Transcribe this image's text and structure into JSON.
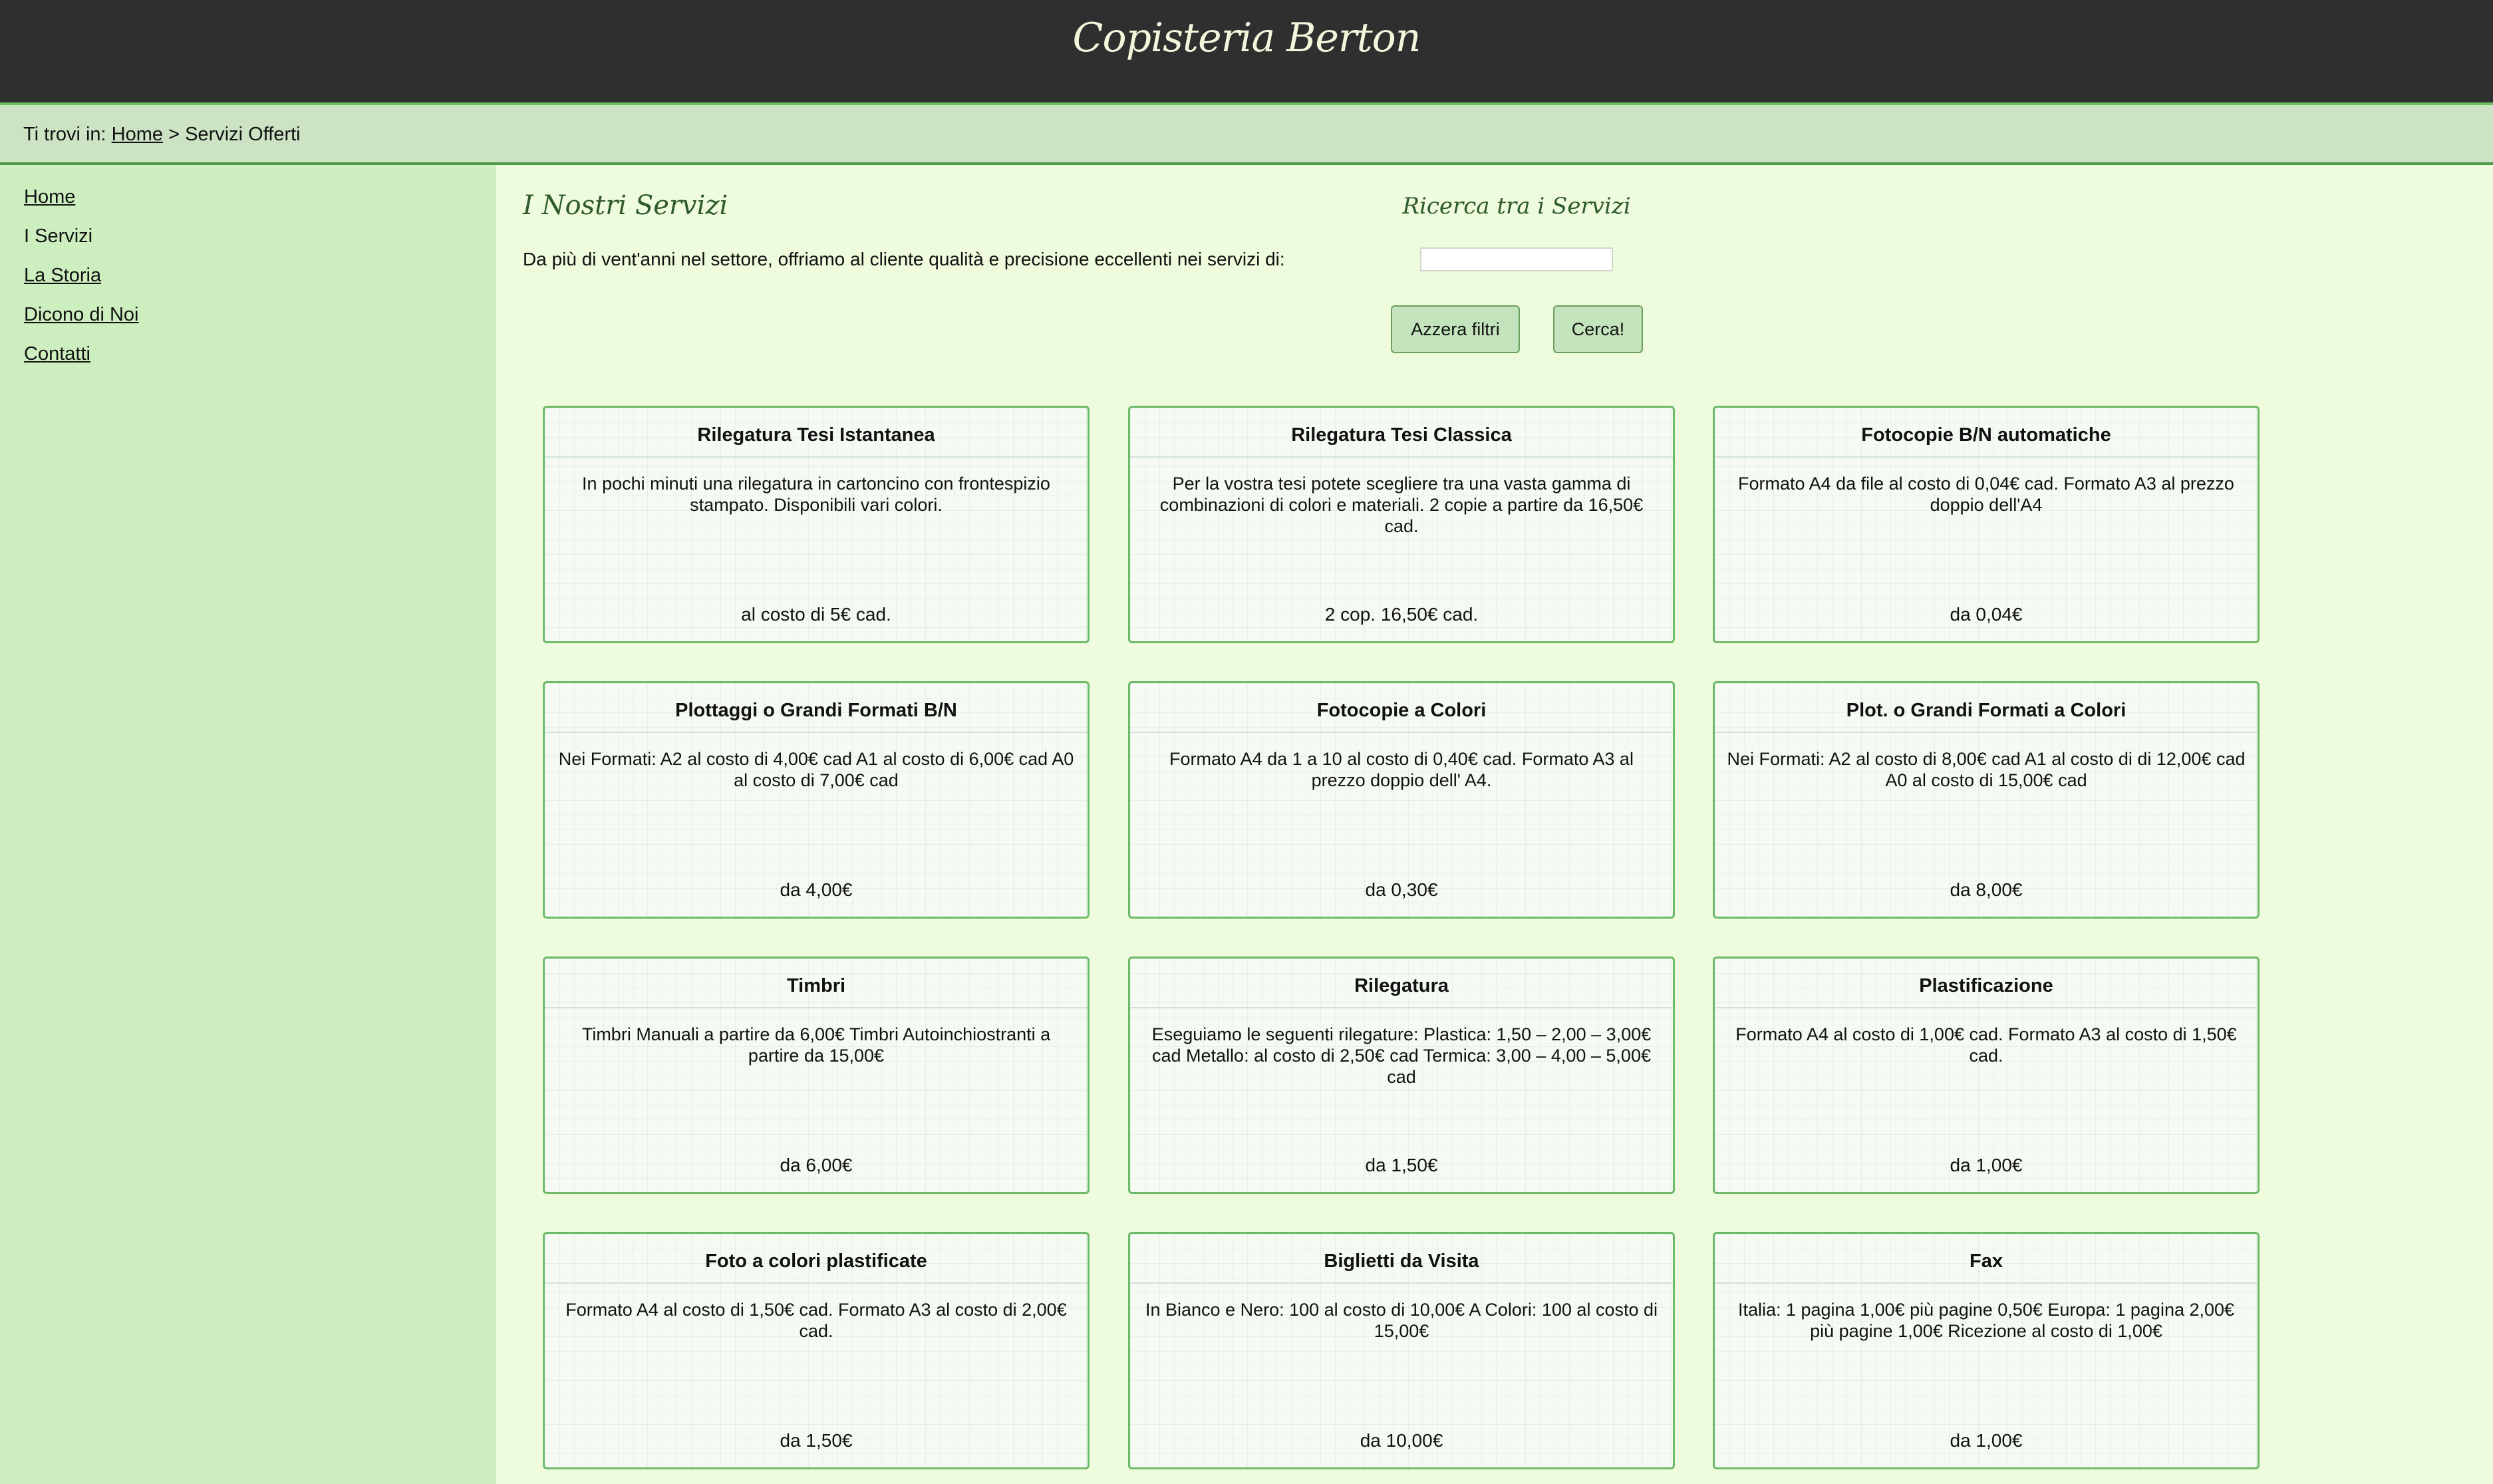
{
  "header": {
    "title": "Copisteria Berton"
  },
  "breadcrumb": {
    "prefix": "Ti trovi in:",
    "home": "Home",
    "separator": ">",
    "current": "Servizi Offerti"
  },
  "sidebar": {
    "items": [
      {
        "label": "Home",
        "link": true
      },
      {
        "label": "I Servizi",
        "link": false
      },
      {
        "label": "La Storia",
        "link": true
      },
      {
        "label": "Dicono di Noi",
        "link": true
      },
      {
        "label": "Contatti",
        "link": true
      }
    ]
  },
  "main": {
    "title": "I Nostri Servizi",
    "intro": "Da più di vent'anni nel settore, offriamo al cliente qualità e precisione eccellenti nei servizi di:"
  },
  "search": {
    "title": "Ricerca tra i Servizi",
    "value": "",
    "reset_label": "Azzera filtri",
    "search_label": "Cerca!"
  },
  "services": [
    {
      "title": "Rilegatura Tesi Istantanea",
      "desc": "In pochi minuti una rilegatura in cartoncino con frontespizio stampato. Disponibili vari colori.",
      "price": "al costo di 5€ cad."
    },
    {
      "title": "Rilegatura Tesi Classica",
      "desc": "Per la vostra tesi potete scegliere tra una vasta gamma di combinazioni di colori e materiali. 2 copie a partire da 16,50€ cad.",
      "price": "2 cop. 16,50€ cad."
    },
    {
      "title": "Fotocopie B/N automatiche",
      "desc": "Formato A4 da file al costo di 0,04€ cad. Formato A3 al prezzo doppio dell'A4",
      "price": "da 0,04€"
    },
    {
      "title": "Plottaggi o Grandi Formati B/N",
      "desc": "Nei Formati: A2 al costo di 4,00€ cad A1 al costo di 6,00€ cad A0 al costo di 7,00€ cad",
      "price": "da 4,00€"
    },
    {
      "title": "Fotocopie a Colori",
      "desc": "Formato A4 da 1 a 10 al costo di 0,40€ cad. Formato A3 al prezzo doppio dell' A4.",
      "price": "da 0,30€"
    },
    {
      "title": "Plot. o Grandi Formati a Colori",
      "desc": "Nei Formati: A2 al costo di 8,00€ cad A1 al costo di di 12,00€ cad A0 al costo di 15,00€ cad",
      "price": "da 8,00€"
    },
    {
      "title": "Timbri",
      "desc": "Timbri Manuali a partire da 6,00€ Timbri Autoinchiostranti a partire da 15,00€",
      "price": "da 6,00€"
    },
    {
      "title": "Rilegatura",
      "desc": "Eseguiamo le seguenti rilegature: Plastica: 1,50 – 2,00 – 3,00€ cad Metallo: al costo di 2,50€ cad Termica: 3,00 – 4,00 – 5,00€ cad",
      "price": "da 1,50€"
    },
    {
      "title": "Plastificazione",
      "desc": "Formato A4 al costo di 1,00€ cad. Formato A3 al costo di 1,50€ cad.",
      "price": "da 1,00€"
    },
    {
      "title": "Foto a colori plastificate",
      "desc": "Formato A4 al costo di 1,50€ cad. Formato A3 al costo di 2,00€ cad.",
      "price": "da 1,50€"
    },
    {
      "title": "Biglietti da Visita",
      "desc": "In Bianco e Nero: 100 al costo di 10,00€ A Colori: 100 al costo di 15,00€",
      "price": "da 10,00€"
    },
    {
      "title": "Fax",
      "desc": "Italia: 1 pagina 1,00€ più pagine 0,50€ Europa: 1 pagina 2,00€ più pagine 1,00€ Ricezione al costo di 1,00€",
      "price": "da 1,00€"
    }
  ],
  "colors": {
    "header_bg": "#2f2f2f",
    "breadcrumb_bg": "#cde4c4",
    "sidebar_bg": "#cdefbf",
    "content_bg": "#eefbdc",
    "card_border": "#6dbb6a",
    "title_green": "#2f5a2c"
  }
}
